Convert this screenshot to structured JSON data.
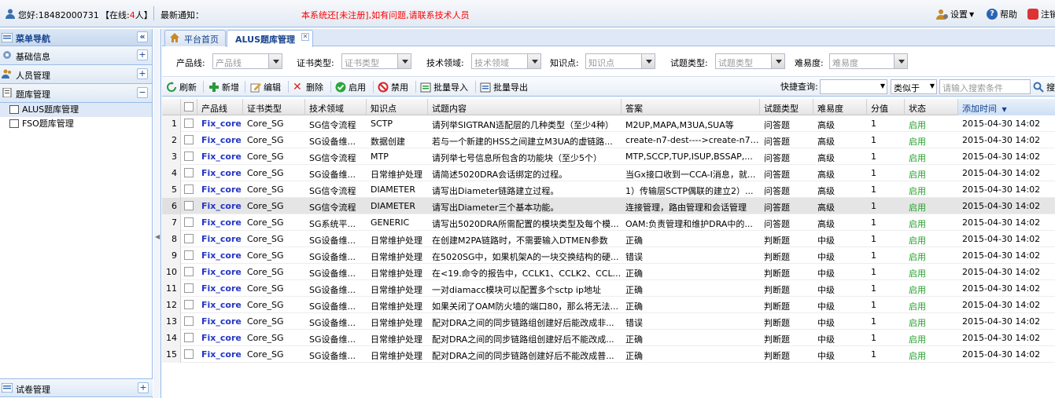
{
  "header": {
    "greeting": "您好:18482000731",
    "online_prefix": "【在线:",
    "online_count": "4",
    "online_suffix": "人】",
    "notice_label": "最新通知：",
    "notice_text": "本系统还[未注册],如有问题,请联系技术人员",
    "settings_label": "设置",
    "help_label": "帮助",
    "logout_label": "注销",
    "accent_color": "#ff0000"
  },
  "sidebar": {
    "title": "菜单导航",
    "sections": [
      {
        "label": "基础信息",
        "toggle": "+"
      },
      {
        "label": "人员管理",
        "toggle": "+"
      },
      {
        "label": "题库管理",
        "toggle": "−"
      }
    ],
    "tree": [
      {
        "label": "ALUS题库管理"
      },
      {
        "label": "FSO题库管理"
      }
    ],
    "bottom_section": {
      "label": "试卷管理",
      "toggle": "+"
    }
  },
  "tabs": [
    {
      "label": "平台首页"
    },
    {
      "label": "ALUS题库管理"
    }
  ],
  "filters": [
    {
      "label": "产品线:",
      "placeholder": "产品线"
    },
    {
      "label": "证书类型:",
      "placeholder": "证书类型"
    },
    {
      "label": "技术领域:",
      "placeholder": "技术领域"
    },
    {
      "label": "知识点:",
      "placeholder": "知识点"
    },
    {
      "label": "试题类型:",
      "placeholder": "试题类型"
    },
    {
      "label": "难易度:",
      "placeholder": "难易度"
    }
  ],
  "toolbar": {
    "refresh": "刷新",
    "add": "新增",
    "edit": "编辑",
    "delete": "删除",
    "enable": "启用",
    "disable": "禁用",
    "import": "批量导入",
    "export": "批量导出",
    "quick_search_label": "快捷查询:",
    "match_mode": "类似于",
    "search_placeholder": "请输入搜索条件",
    "search_button": "搜"
  },
  "grid": {
    "columns": [
      "产品线",
      "证书类型",
      "技术领域",
      "知识点",
      "试题内容",
      "答案",
      "试题类型",
      "难易度",
      "分值",
      "状态",
      "添加时间"
    ],
    "rows": [
      {
        "n": "1",
        "product": "Fix_core",
        "cert": "Core_SG",
        "field": "SG信令流程",
        "point": "SCTP",
        "content": "请列举SIGTRAN适配层的几种类型（至少4种）",
        "answer": "M2UP,MAPA,M3UA,SUA等",
        "type": "问答题",
        "level": "高级",
        "score": "1",
        "status": "启用",
        "time": "2015-04-30 14:02"
      },
      {
        "n": "2",
        "product": "Fix_core",
        "cert": "Core_SG",
        "field": "SG设备维...",
        "point": "数据创建",
        "content": "若与一个新建的HSS之间建立M3UA的虚链路...",
        "answer": "create-n7-dest---->create-n7-lk...",
        "type": "问答题",
        "level": "高级",
        "score": "1",
        "status": "启用",
        "time": "2015-04-30 14:02"
      },
      {
        "n": "3",
        "product": "Fix_core",
        "cert": "Core_SG",
        "field": "SG信令流程",
        "point": "MTP",
        "content": "请列举七号信息所包含的功能块（至少5个）",
        "answer": "MTP,SCCP,TUP,ISUP,BSSAP,...",
        "type": "问答题",
        "level": "高级",
        "score": "1",
        "status": "启用",
        "time": "2015-04-30 14:02"
      },
      {
        "n": "4",
        "product": "Fix_core",
        "cert": "Core_SG",
        "field": "SG设备维...",
        "point": "日常维护处理",
        "content": "请简述5020DRA会话绑定的过程。",
        "answer": "当Gx接口收到一CCA-I消息，就...",
        "type": "问答题",
        "level": "高级",
        "score": "1",
        "status": "启用",
        "time": "2015-04-30 14:02"
      },
      {
        "n": "5",
        "product": "Fix_core",
        "cert": "Core_SG",
        "field": "SG信令流程",
        "point": "DIAMETER",
        "content": "请写出Diameter链路建立过程。",
        "answer": "1）传输层SCTP偶联的建立2）...",
        "type": "问答题",
        "level": "高级",
        "score": "1",
        "status": "启用",
        "time": "2015-04-30 14:02"
      },
      {
        "n": "6",
        "product": "Fix_core",
        "cert": "Core_SG",
        "field": "SG信令流程",
        "point": "DIAMETER",
        "content": "请写出Diameter三个基本功能。",
        "answer": "连接管理，路由管理和会话管理",
        "type": "问答题",
        "level": "高级",
        "score": "1",
        "status": "启用",
        "time": "2015-04-30 14:02"
      },
      {
        "n": "7",
        "product": "Fix_core",
        "cert": "Core_SG",
        "field": "SG系统平...",
        "point": "GENERIC",
        "content": "请写出5020DRA所需配置的模块类型及每个模...",
        "answer": "OAM:负责管理和维护DRA中的...",
        "type": "问答题",
        "level": "高级",
        "score": "1",
        "status": "启用",
        "time": "2015-04-30 14:02"
      },
      {
        "n": "8",
        "product": "Fix_core",
        "cert": "Core_SG",
        "field": "SG设备维...",
        "point": "日常维护处理",
        "content": "在创建M2PA链路时，不需要输入DTMEN参数",
        "answer": "正确",
        "type": "判断题",
        "level": "中级",
        "score": "1",
        "status": "启用",
        "time": "2015-04-30 14:02"
      },
      {
        "n": "9",
        "product": "Fix_core",
        "cert": "Core_SG",
        "field": "SG设备维...",
        "point": "日常维护处理",
        "content": "在5020SG中，如果机架A的一块交换结构的硬...",
        "answer": "错误",
        "type": "判断题",
        "level": "中级",
        "score": "1",
        "status": "启用",
        "time": "2015-04-30 14:02"
      },
      {
        "n": "10",
        "product": "Fix_core",
        "cert": "Core_SG",
        "field": "SG设备维...",
        "point": "日常维护处理",
        "content": "在<19.命令的报告中，CCLK1、CCLK2、CCL...",
        "answer": "正确",
        "type": "判断题",
        "level": "中级",
        "score": "1",
        "status": "启用",
        "time": "2015-04-30 14:02"
      },
      {
        "n": "11",
        "product": "Fix_core",
        "cert": "Core_SG",
        "field": "SG设备维...",
        "point": "日常维护处理",
        "content": "一对diamacc模块可以配置多个sctp ip地址",
        "answer": "正确",
        "type": "判断题",
        "level": "中级",
        "score": "1",
        "status": "启用",
        "time": "2015-04-30 14:02"
      },
      {
        "n": "12",
        "product": "Fix_core",
        "cert": "Core_SG",
        "field": "SG设备维...",
        "point": "日常维护处理",
        "content": "如果关闭了OAM防火墙的端口80，那么将无法...",
        "answer": "正确",
        "type": "判断题",
        "level": "中级",
        "score": "1",
        "status": "启用",
        "time": "2015-04-30 14:02"
      },
      {
        "n": "13",
        "product": "Fix_core",
        "cert": "Core_SG",
        "field": "SG设备维...",
        "point": "日常维护处理",
        "content": "配对DRA之间的同步链路组创建好后能改成非...",
        "answer": "错误",
        "type": "判断题",
        "level": "中级",
        "score": "1",
        "status": "启用",
        "time": "2015-04-30 14:02"
      },
      {
        "n": "14",
        "product": "Fix_core",
        "cert": "Core_SG",
        "field": "SG设备维...",
        "point": "日常维护处理",
        "content": "配对DRA之间的同步链路组创建好后不能改成...",
        "answer": "正确",
        "type": "判断题",
        "level": "中级",
        "score": "1",
        "status": "启用",
        "time": "2015-04-30 14:02"
      },
      {
        "n": "15",
        "product": "Fix_core",
        "cert": "Core_SG",
        "field": "SG设备维...",
        "point": "日常维护处理",
        "content": "配对DRA之间的同步链路创建好后不能改成普...",
        "answer": "正确",
        "type": "判断题",
        "level": "中级",
        "score": "1",
        "status": "启用",
        "time": "2015-04-30 14:02"
      }
    ],
    "selected_row": 6,
    "sort_column": "添加时间"
  }
}
